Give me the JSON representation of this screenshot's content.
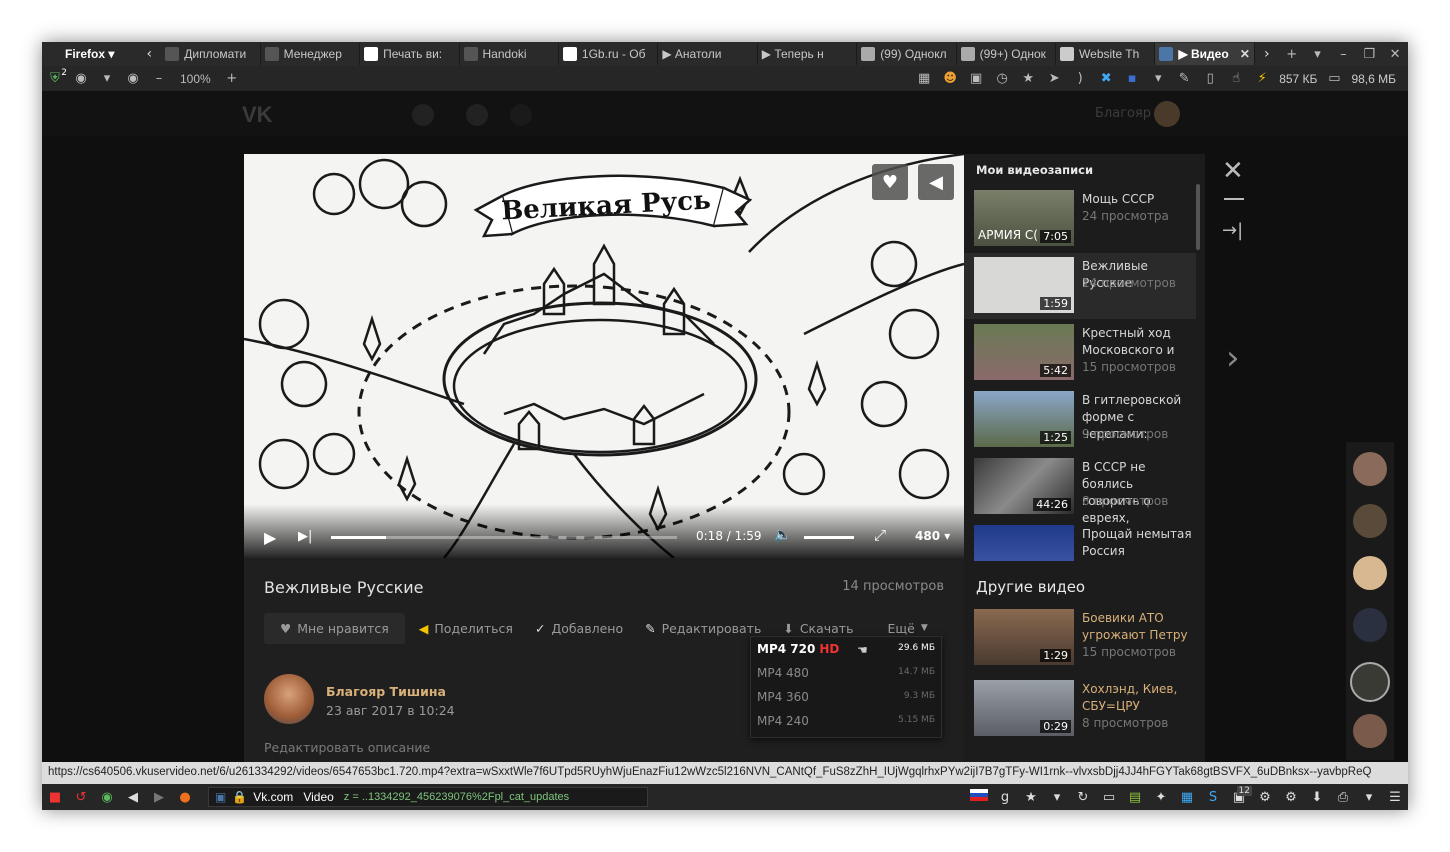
{
  "browser": {
    "menu_label": "Firefox",
    "tabs": [
      {
        "label": "Дипломати"
      },
      {
        "label": "Менеджер"
      },
      {
        "label": "Печать ви:"
      },
      {
        "label": "Handoki"
      },
      {
        "label": "1Gb.ru - Об"
      },
      {
        "label": "▶ Анатоли"
      },
      {
        "label": "▶ Теперь н"
      },
      {
        "label": "(99) Однокл"
      },
      {
        "label": "(99+) Однок"
      },
      {
        "label": "Website Th"
      },
      {
        "label": "▶ Видео"
      }
    ],
    "zoom": "100%",
    "badge_count": "2",
    "stat_download": "857 КБ",
    "stat_memory": "98,6 МБ",
    "status_url": "https://cs640506.vkuservideo.net/6/u261334292/videos/6547653bc1.720.mp4?extra=wSxxtWle7f6UTpd5RUyhWjuEnazFiu12wWzc5l216NVN_CANtQf_FuS8zZhH_IUjWgqlrhxPYw2ijI7B7gTFy-WI1rnk--vlvxsbDjj4JJ4hFGYTak68gtBSVFX_6uDBnksx--yavbpReQ",
    "address": {
      "site": "Vk.com",
      "section": "Video",
      "path": "z = ..1334292_456239076%2Fpl_cat_updates"
    },
    "bottom_badge": "12"
  },
  "vk": {
    "logo": "VK",
    "user_name": "Благояр"
  },
  "player": {
    "banner_text": "Великая Русь",
    "time": "0:18 / 1:59",
    "quality": "480 ▾",
    "progress": 0.16
  },
  "video": {
    "title": "Вежливые Русские",
    "views": "14 просмотров",
    "actions": {
      "like": "Мне нравится",
      "share": "Поделиться",
      "added": "Добавлено",
      "edit": "Редактировать",
      "download": "Скачать",
      "more": "Ещё"
    },
    "author": {
      "name": "Благояр Тишина",
      "date": "23 авг 2017 в 10:24"
    },
    "edit_description": "Редактировать описание"
  },
  "download_menu": {
    "hd_label": "HD",
    "items": [
      {
        "format": "MP4 720",
        "size": "29.6 МБ"
      },
      {
        "format": "MP4 480",
        "size": "14.7 МБ"
      },
      {
        "format": "MP4 360",
        "size": "9.3 МБ"
      },
      {
        "format": "MP4 240",
        "size": "5.15 МБ"
      }
    ]
  },
  "sidebar": {
    "my_videos_title": "Мои видеозаписи",
    "my_videos": [
      {
        "title": "Мощь СССР",
        "views": "24 просмотра",
        "duration": "7:05",
        "thumb_text": "АРМИЯ С("
      },
      {
        "title": "Вежливые Русские",
        "views": "14 просмотров",
        "duration": "1:59"
      },
      {
        "title": "Крестный ход Московского и",
        "views": "15 просмотров",
        "duration": "5:42"
      },
      {
        "title": "В гитлеровской форме с черепами:",
        "views": "9 просмотров",
        "duration": "1:25"
      },
      {
        "title": "В СССР не боялись говорить о евреях,",
        "views": "8 просмотров",
        "duration": "44:26"
      },
      {
        "title": "Прощай немытая Россия",
        "views": "",
        "duration": ""
      }
    ],
    "other_title": "Другие видео",
    "other_videos": [
      {
        "title": "Боевики АТО угрожают Петру",
        "views": "15 просмотров",
        "duration": "1:29"
      },
      {
        "title": "Хохлэнд, Киев, СБУ=ЦРУ",
        "views": "8 просмотров",
        "duration": "0:29"
      }
    ]
  }
}
